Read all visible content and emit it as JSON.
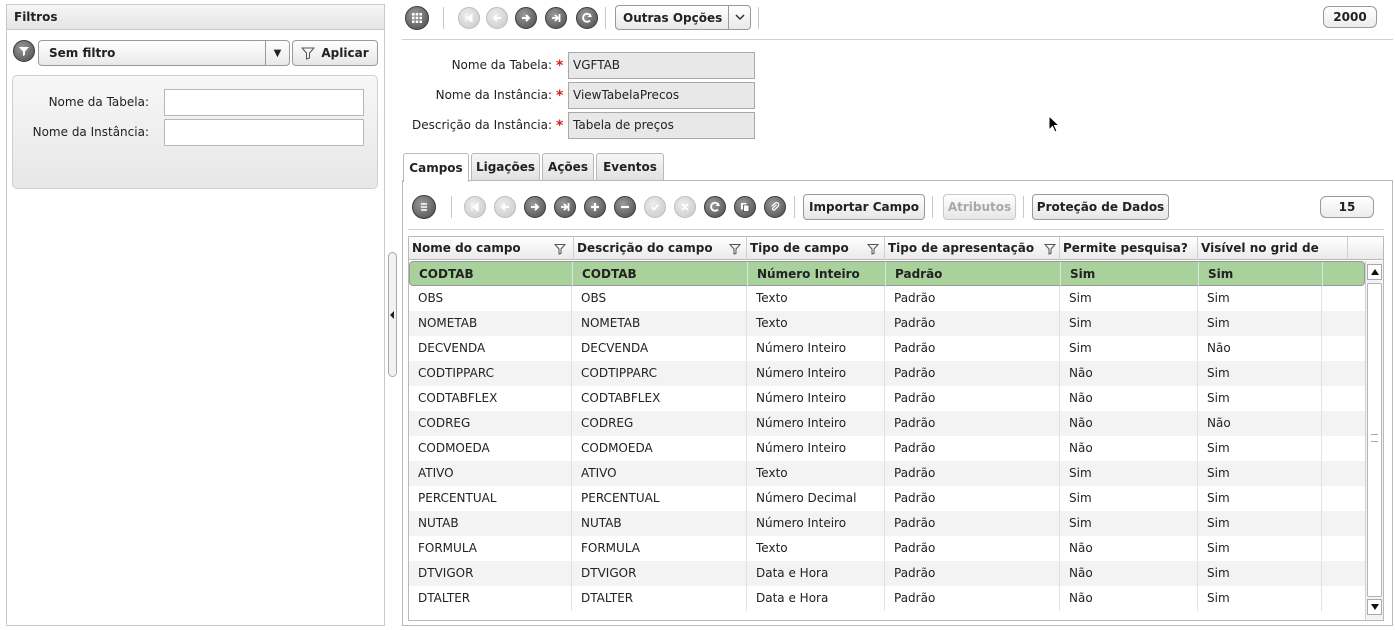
{
  "filters": {
    "title": "Filtros",
    "filter_select": "Sem filtro",
    "apply_label": "Aplicar",
    "fields": [
      {
        "label": "Nome da Tabela:",
        "value": ""
      },
      {
        "label": "Nome da Instância:",
        "value": ""
      }
    ]
  },
  "toolbar": {
    "more_options": "Outras Opções",
    "record_count": "2000"
  },
  "form": {
    "fields": [
      {
        "label": "Nome da Tabela:",
        "value": "VGFTAB"
      },
      {
        "label": "Nome da Instância:",
        "value": "ViewTabelaPrecos"
      },
      {
        "label": "Descrição da Instância:",
        "value": "Tabela de preços"
      }
    ],
    "required_mark": "*"
  },
  "tabs": [
    "Campos",
    "Ligações",
    "Ações",
    "Eventos"
  ],
  "grid_toolbar": {
    "import_label": "Importar Campo",
    "attributes_label": "Atributos",
    "protection_label": "Proteção de Dados",
    "page_size": "15"
  },
  "grid": {
    "columns": [
      "Nome do campo",
      "Descrição do campo",
      "Tipo de campo",
      "Tipo de apresentação",
      "Permite pesquisa?",
      "Visível no grid de"
    ],
    "rows": [
      [
        "CODTAB",
        "CODTAB",
        "Número Inteiro",
        "Padrão",
        "Sim",
        "Sim"
      ],
      [
        "OBS",
        "OBS",
        "Texto",
        "Padrão",
        "Sim",
        "Sim"
      ],
      [
        "NOMETAB",
        "NOMETAB",
        "Texto",
        "Padrão",
        "Sim",
        "Sim"
      ],
      [
        "DECVENDA",
        "DECVENDA",
        "Número Inteiro",
        "Padrão",
        "Sim",
        "Não"
      ],
      [
        "CODTIPPARC",
        "CODTIPPARC",
        "Número Inteiro",
        "Padrão",
        "Não",
        "Sim"
      ],
      [
        "CODTABFLEX",
        "CODTABFLEX",
        "Número Inteiro",
        "Padrão",
        "Não",
        "Sim"
      ],
      [
        "CODREG",
        "CODREG",
        "Número Inteiro",
        "Padrão",
        "Não",
        "Não"
      ],
      [
        "CODMOEDA",
        "CODMOEDA",
        "Número Inteiro",
        "Padrão",
        "Não",
        "Sim"
      ],
      [
        "ATIVO",
        "ATIVO",
        "Texto",
        "Padrão",
        "Sim",
        "Sim"
      ],
      [
        "PERCENTUAL",
        "PERCENTUAL",
        "Número Decimal",
        "Padrão",
        "Sim",
        "Sim"
      ],
      [
        "NUTAB",
        "NUTAB",
        "Número Inteiro",
        "Padrão",
        "Sim",
        "Sim"
      ],
      [
        "FORMULA",
        "FORMULA",
        "Texto",
        "Padrão",
        "Não",
        "Sim"
      ],
      [
        "DTVIGOR",
        "DTVIGOR",
        "Data e Hora",
        "Padrão",
        "Não",
        "Sim"
      ],
      [
        "DTALTER",
        "DTALTER",
        "Data e Hora",
        "Padrão",
        "Não",
        "Sim"
      ]
    ],
    "selected_row": 0
  },
  "colors": {
    "selected_row": "#a8d19b",
    "required": "#d42020"
  }
}
